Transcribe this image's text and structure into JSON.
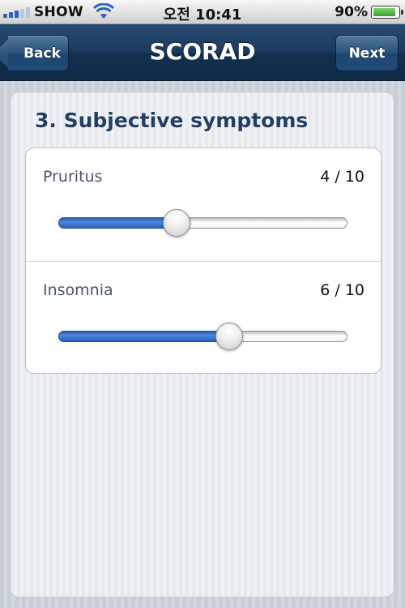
{
  "status_bar": {
    "carrier": "SHOW",
    "time": "오전 10:41",
    "battery": "90%",
    "battery_level": 0.9
  },
  "nav": {
    "title": "SCORAD",
    "back_label": "Back",
    "next_label": "Next"
  },
  "section": {
    "title": "3. Subjective symptoms"
  },
  "symptoms": [
    {
      "label": "Pruritus",
      "value_text": "4 / 10",
      "value": 4,
      "max": 10
    },
    {
      "label": "Insomnia",
      "value_text": "6 / 10",
      "value": 6,
      "max": 10
    }
  ],
  "colors": {
    "nav_bar": "#1c3a5d",
    "slider_fill": "#3e78d2",
    "section_title": "#223f63"
  }
}
